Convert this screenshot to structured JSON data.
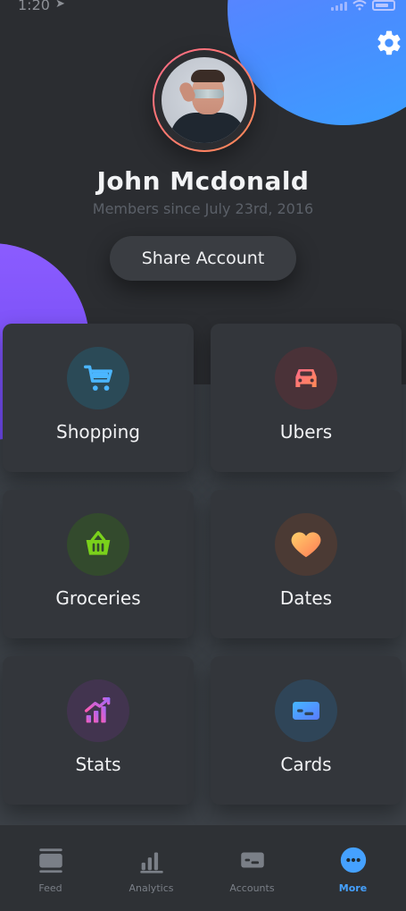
{
  "status_bar": {
    "time": "1:20"
  },
  "profile": {
    "name": "John Mcdonald",
    "member_since": "Members since July 23rd, 2016",
    "share_label": "Share Account"
  },
  "tiles": [
    {
      "label": "Shopping",
      "icon": "cart-icon",
      "color": "#4bb6ff"
    },
    {
      "label": "Ubers",
      "icon": "car-icon",
      "color": "#ff5a6f"
    },
    {
      "label": "Groceries",
      "icon": "basket-icon",
      "color": "#7ad11b"
    },
    {
      "label": "Dates",
      "icon": "heart-icon",
      "color": "#ffb347"
    },
    {
      "label": "Stats",
      "icon": "bar-chart-icon",
      "color": "#b85cff"
    },
    {
      "label": "Cards",
      "icon": "card-icon",
      "color": "#5aa8ff"
    }
  ],
  "tabbar": [
    {
      "label": "Feed",
      "icon": "feed-icon",
      "active": false
    },
    {
      "label": "Analytics",
      "icon": "analytics-icon",
      "active": false
    },
    {
      "label": "Accounts",
      "icon": "accounts-icon",
      "active": false
    },
    {
      "label": "More",
      "icon": "more-icon",
      "active": true
    }
  ],
  "colors": {
    "accent_blue": "#45a1ff",
    "profile_ring": "#ff7a6d",
    "blob_blue": "#4a8cff",
    "blob_purple": "#7b4df4"
  }
}
